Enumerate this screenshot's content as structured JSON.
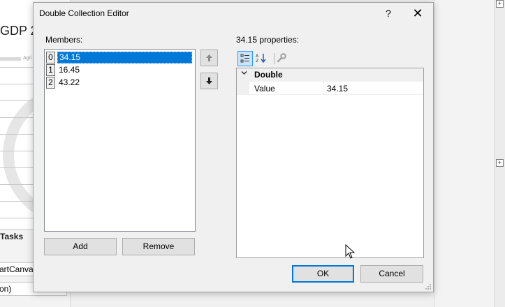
{
  "background": {
    "title_fragment": "GDP 2",
    "tiny_text": "Agri",
    "tasks_label": "Tasks",
    "field1": "artCanva",
    "field2": "on)",
    "expander_glyph": "+"
  },
  "dialog": {
    "title": "Double Collection Editor",
    "help_glyph": "?",
    "close_glyph": "✕",
    "members_label": "Members:",
    "members": [
      {
        "index": "0",
        "value": "34.15",
        "selected": true
      },
      {
        "index": "1",
        "value": "16.45",
        "selected": false
      },
      {
        "index": "2",
        "value": "43.22",
        "selected": false
      }
    ],
    "move_up_glyph": "🡅",
    "move_down_glyph": "🡇",
    "add_label": "Add",
    "remove_label": "Remove",
    "properties_label": "34.15 properties:",
    "toolbar": {
      "categorized_icon": "categorized-icon",
      "alphabetical_icon": "alphabetical-icon",
      "property_pages_icon": "wrench-icon"
    },
    "property_grid": {
      "category": "Double",
      "rows": [
        {
          "name": "Value",
          "value": "34.15"
        }
      ]
    },
    "ok_label": "OK",
    "cancel_label": "Cancel"
  },
  "colors": {
    "selection": "#0078d7",
    "default_button_border": "#0078d7",
    "dialog_bg": "#f0f0f0"
  }
}
